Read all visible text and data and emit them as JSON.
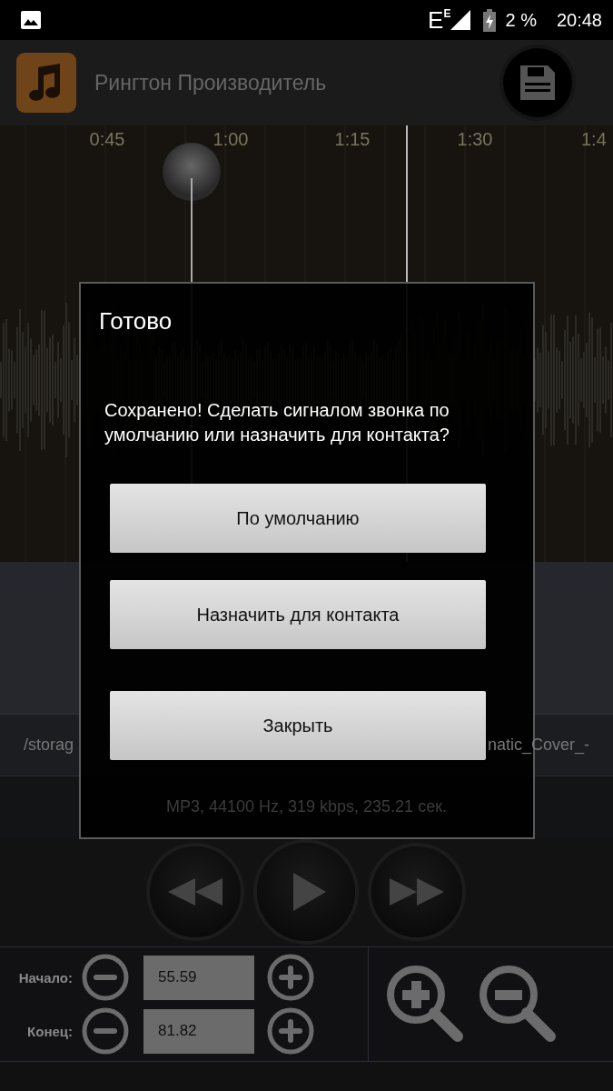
{
  "status_bar": {
    "network": "E",
    "network_sup": "E",
    "battery": "2 %",
    "time": "20:48"
  },
  "app_bar": {
    "title": "Рингтон Производитель"
  },
  "waveform": {
    "time_labels": [
      "0:45",
      "1:00",
      "1:15",
      "1:30",
      "1:4"
    ]
  },
  "file": {
    "path_start": "/storag",
    "path_end": "natic_Cover_-",
    "info": "MP3, 44100 Hz, 319 kbps, 235.21 сек."
  },
  "trim": [
    {
      "label": "Начало:",
      "value": "55.59"
    },
    {
      "label": "Конец:",
      "value": "81.82"
    }
  ],
  "dialog": {
    "title": "Готово",
    "message": "Сохранено! Сделать сигналом звонка по умолчанию или назначить для контакта?",
    "buttons": [
      "По умолчанию",
      "Назначить для контакта",
      "Закрыть"
    ]
  }
}
